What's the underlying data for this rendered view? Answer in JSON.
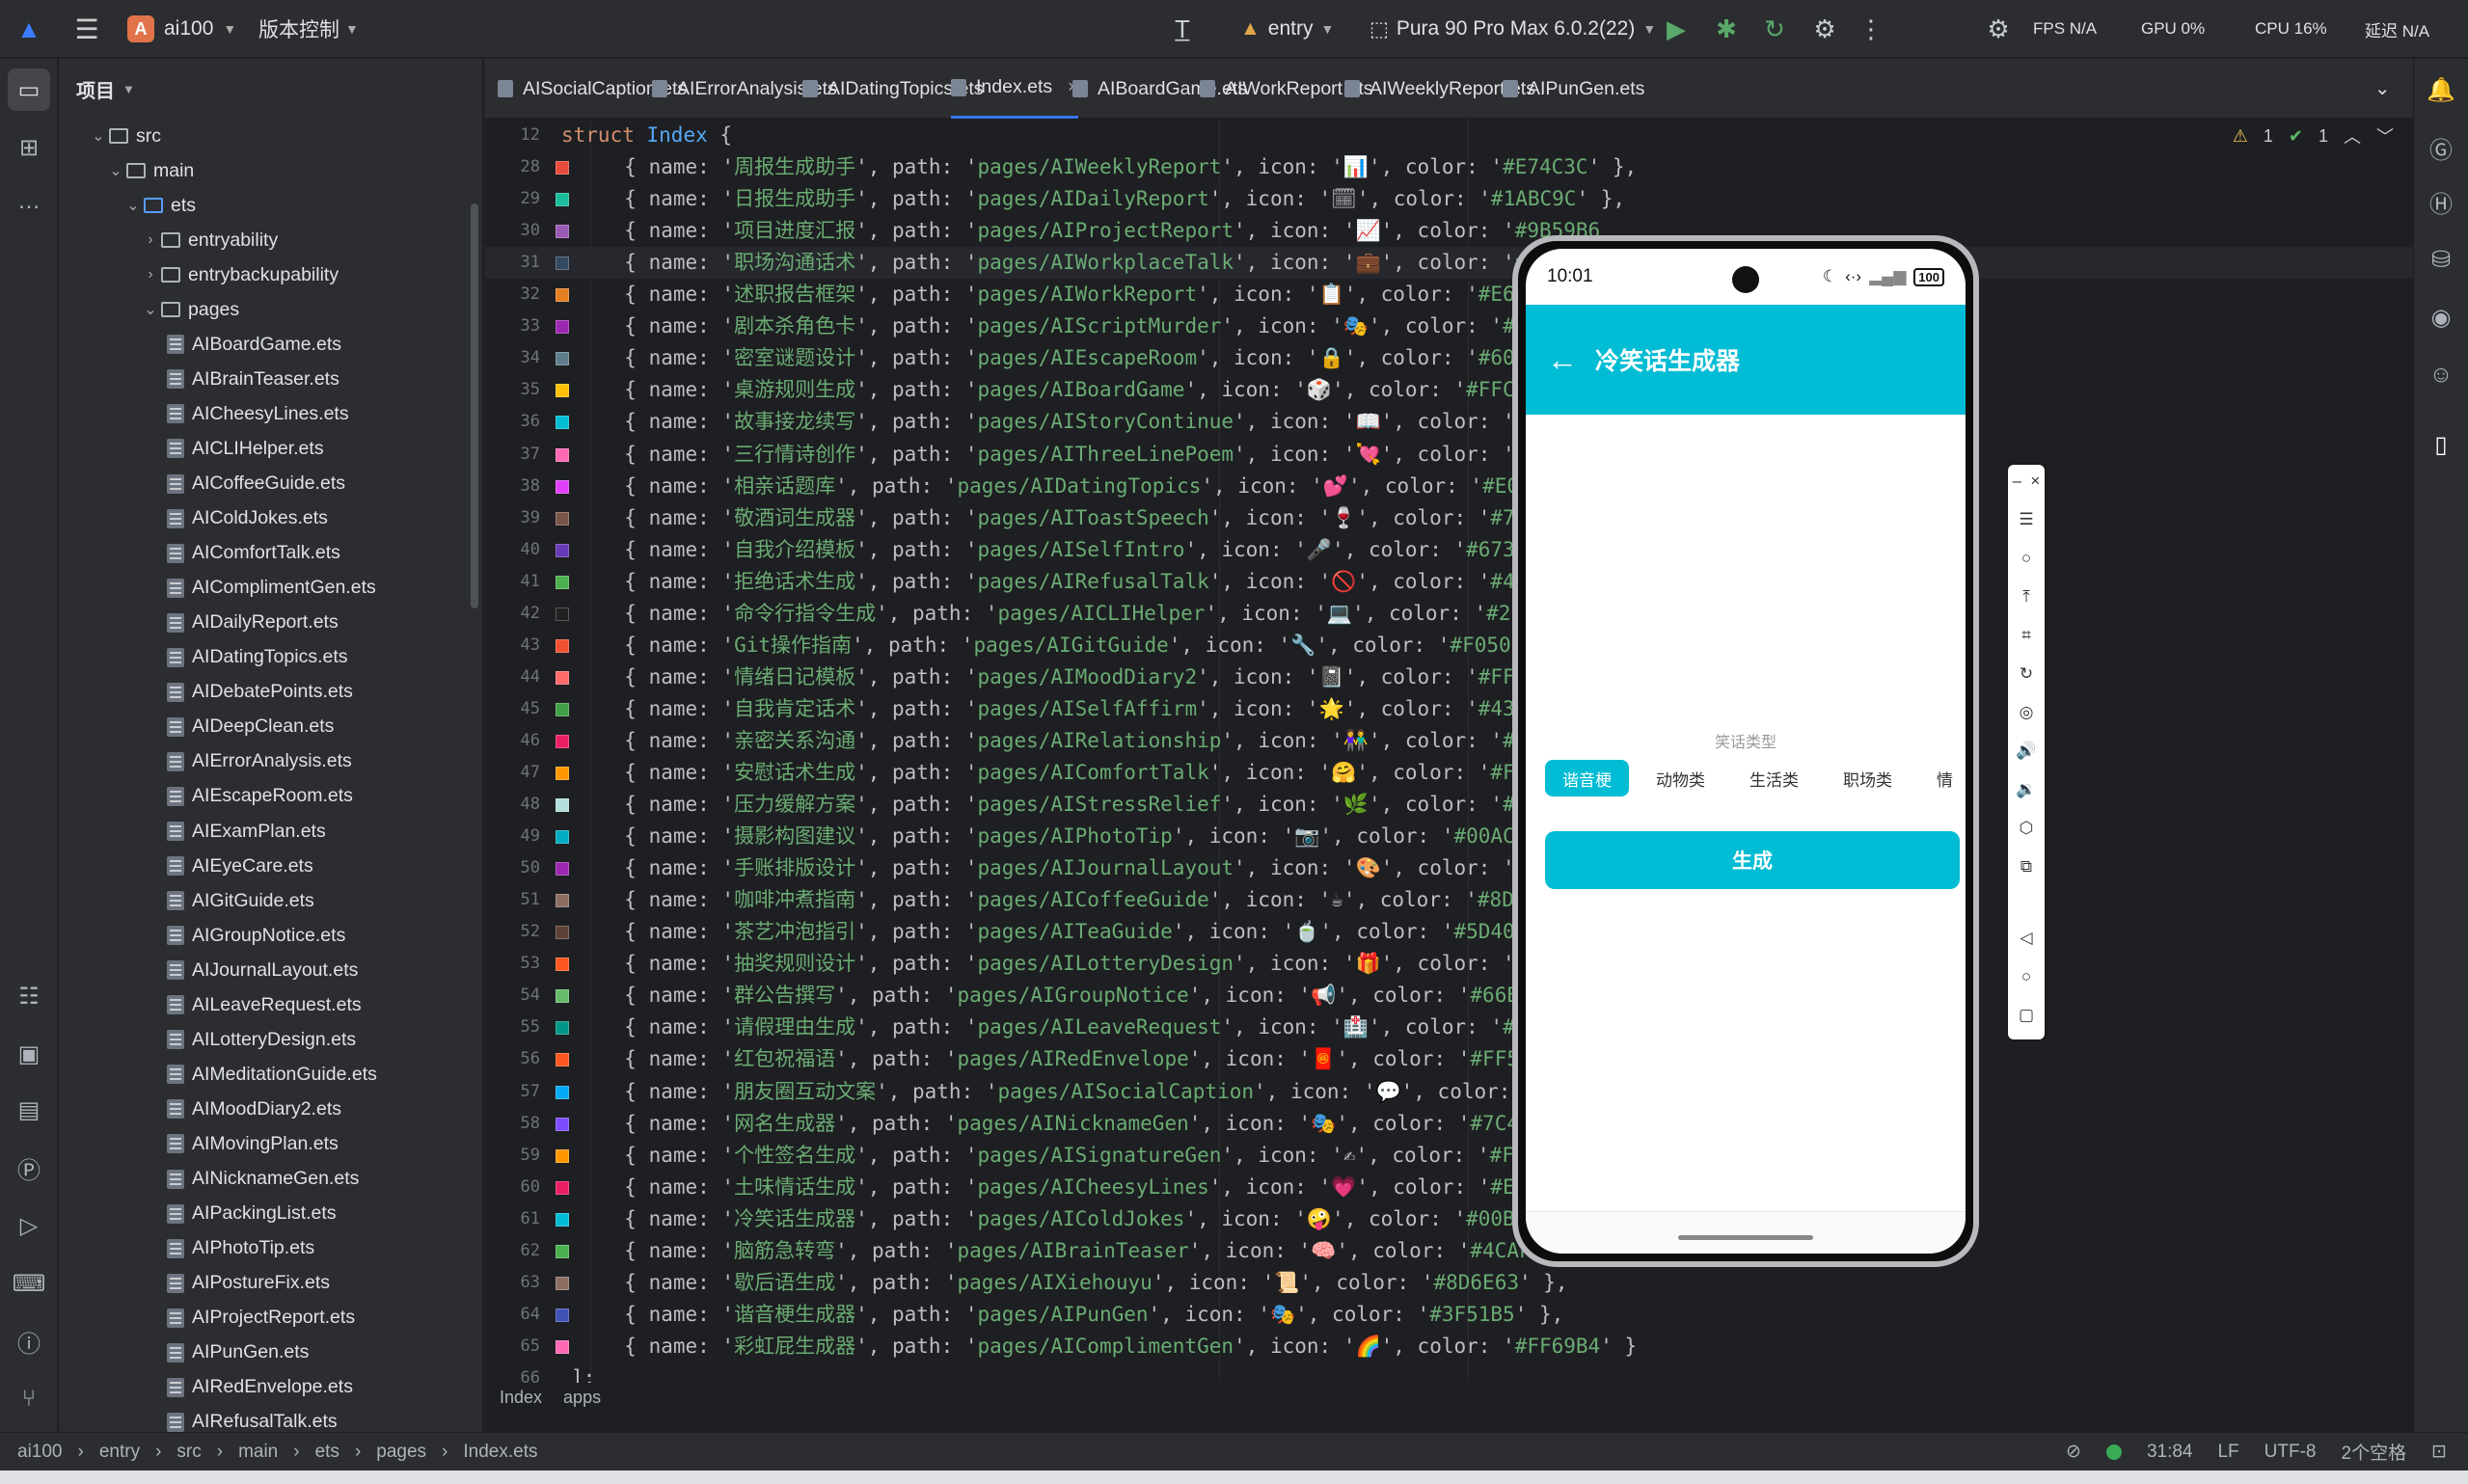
{
  "topbar": {
    "project_letter": "A",
    "project_name": "ai100",
    "vcs": "版本控制",
    "module": "entry",
    "device": "Pura 90 Pro Max 6.0.2(22)",
    "fps": "FPS N/A",
    "gpu": "GPU 0%",
    "cpu": "CPU 16%",
    "latency": "延迟 N/A"
  },
  "project_panel": {
    "title": "项目",
    "folders": [
      "src",
      "main",
      "ets",
      "entryability",
      "entrybackupability",
      "pages"
    ],
    "files": [
      "AIBoardGame.ets",
      "AIBrainTeaser.ets",
      "AICheesyLines.ets",
      "AICLIHelper.ets",
      "AICoffeeGuide.ets",
      "AIColdJokes.ets",
      "AIComfortTalk.ets",
      "AIComplimentGen.ets",
      "AIDailyReport.ets",
      "AIDatingTopics.ets",
      "AIDebatePoints.ets",
      "AIDeepClean.ets",
      "AIErrorAnalysis.ets",
      "AIEscapeRoom.ets",
      "AIExamPlan.ets",
      "AIEyeCare.ets",
      "AIGitGuide.ets",
      "AIGroupNotice.ets",
      "AIJournalLayout.ets",
      "AILeaveRequest.ets",
      "AILotteryDesign.ets",
      "AIMeditationGuide.ets",
      "AIMoodDiary2.ets",
      "AIMovingPlan.ets",
      "AINicknameGen.ets",
      "AIPackingList.ets",
      "AIPhotoTip.ets",
      "AIPostureFix.ets",
      "AIProjectReport.ets",
      "AIPunGen.ets",
      "AIRedEnvelope.ets",
      "AIRefusalTalk.ets"
    ]
  },
  "tabs": [
    "AISocialCaption.ets",
    "AIErrorAnalysis.ets",
    "AIDatingTopics.ets",
    "Index.ets",
    "AIBoardGame.ets",
    "AIWorkReport.ets",
    "AIWeeklyReport.ets",
    "AIPunGen.ets"
  ],
  "editor": {
    "header_kw": "struct",
    "header_cls": "Index",
    "header_tail": " {",
    "warnings": "1",
    "checks": "1",
    "lines": [
      {
        "n": "28",
        "name": "周报生成助手",
        "path": "pages/AIWeeklyReport",
        "icon": "📊",
        "color": "#E74C3C",
        "tail": "' },"
      },
      {
        "n": "29",
        "name": "日报生成助手",
        "path": "pages/AIDailyReport",
        "icon": "🗓",
        "color": "#1ABC9C",
        "tail": "' },"
      },
      {
        "n": "30",
        "name": "项目进度汇报",
        "path": "pages/AIProjectReport",
        "icon": "📈",
        "color": "#9B59B6",
        "tail": ""
      },
      {
        "n": "31",
        "name": "职场沟通话术",
        "path": "pages/AIWorkplaceTalk",
        "icon": "💼",
        "color": "#34495E",
        "tail": ""
      },
      {
        "n": "32",
        "name": "述职报告框架",
        "path": "pages/AIWorkReport",
        "icon": "📋",
        "color": "#E67E22",
        "tail": ""
      },
      {
        "n": "33",
        "name": "剧本杀角色卡",
        "path": "pages/AIScriptMurder",
        "icon": "🎭",
        "color": "#9C27B0",
        "tail": ""
      },
      {
        "n": "34",
        "name": "密室谜题设计",
        "path": "pages/AIEscapeRoom",
        "icon": "🔒",
        "color": "#607D8B",
        "tail": ""
      },
      {
        "n": "35",
        "name": "桌游规则生成",
        "path": "pages/AIBoardGame",
        "icon": "🎲",
        "color": "#FFC107",
        "tail": ""
      },
      {
        "n": "36",
        "name": "故事接龙续写",
        "path": "pages/AIStoryContinue",
        "icon": "📖",
        "color": "#00BCD4",
        "tail": ""
      },
      {
        "n": "37",
        "name": "三行情诗创作",
        "path": "pages/AIThreeLinePoem",
        "icon": "💘",
        "color": "#FF69B4",
        "tail": ""
      },
      {
        "n": "38",
        "name": "相亲话题库",
        "path": "pages/AIDatingTopics",
        "icon": "💕",
        "color": "#E040FB",
        "tail": ""
      },
      {
        "n": "39",
        "name": "敬酒词生成器",
        "path": "pages/AIToastSpeech",
        "icon": "🍷",
        "color": "#795548",
        "tail": ""
      },
      {
        "n": "40",
        "name": "自我介绍模板",
        "path": "pages/AISelfIntro",
        "icon": "🎤",
        "color": "#673AB7",
        "tail": ""
      },
      {
        "n": "41",
        "name": "拒绝话术生成",
        "path": "pages/AIRefusalTalk",
        "icon": "🚫",
        "color": "#4CAF50",
        "tail": ""
      },
      {
        "n": "42",
        "name": "命令行指令生成",
        "path": "pages/AICLIHelper",
        "icon": "💻",
        "color": "#212121",
        "tail": ""
      },
      {
        "n": "43",
        "name": "Git操作指南",
        "path": "pages/AIGitGuide",
        "icon": "🔧",
        "color": "#F05032",
        "tail": ""
      },
      {
        "n": "44",
        "name": "情绪日记模板",
        "path": "pages/AIMoodDiary2",
        "icon": "📓",
        "color": "#FF6B6B",
        "tail": ""
      },
      {
        "n": "45",
        "name": "自我肯定话术",
        "path": "pages/AISelfAffirm",
        "icon": "🌟",
        "color": "#43A047",
        "tail": ""
      },
      {
        "n": "46",
        "name": "亲密关系沟通",
        "path": "pages/AIRelationship",
        "icon": "👫",
        "color": "#E91E63",
        "tail": ""
      },
      {
        "n": "47",
        "name": "安慰话术生成",
        "path": "pages/AIComfortTalk",
        "icon": "🤗",
        "color": "#FF9800",
        "tail": ""
      },
      {
        "n": "48",
        "name": "压力缓解方案",
        "path": "pages/AIStressRelief",
        "icon": "🌿",
        "color": "#B2DFDB",
        "tail": ""
      },
      {
        "n": "49",
        "name": "摄影构图建议",
        "path": "pages/AIPhotoTip",
        "icon": "📷",
        "color": "#00ACC1",
        "tail": ""
      },
      {
        "n": "50",
        "name": "手账排版设计",
        "path": "pages/AIJournalLayout",
        "icon": "🎨",
        "color": "#9C27B0",
        "tail": ""
      },
      {
        "n": "51",
        "name": "咖啡冲煮指南",
        "path": "pages/AICoffeeGuide",
        "icon": "☕",
        "color": "#8D6E63",
        "tail": ""
      },
      {
        "n": "52",
        "name": "茶艺冲泡指引",
        "path": "pages/AITeaGuide",
        "icon": "🍵",
        "color": "#5D4037",
        "tail": ""
      },
      {
        "n": "53",
        "name": "抽奖规则设计",
        "path": "pages/AILotteryDesign",
        "icon": "🎁",
        "color": "#FF5722",
        "tail": ""
      },
      {
        "n": "54",
        "name": "群公告撰写",
        "path": "pages/AIGroupNotice",
        "icon": "📢",
        "color": "#66BB6A",
        "tail": ""
      },
      {
        "n": "55",
        "name": "请假理由生成",
        "path": "pages/AILeaveRequest",
        "icon": "🏥",
        "color": "#009688",
        "tail": ""
      },
      {
        "n": "56",
        "name": "红包祝福语",
        "path": "pages/AIRedEnvelope",
        "icon": "🧧",
        "color": "#FF5722",
        "tail": ""
      },
      {
        "n": "57",
        "name": "朋友圈互动文案",
        "path": "pages/AISocialCaption",
        "icon": "💬",
        "color": "#03A9F4",
        "tail": ""
      },
      {
        "n": "58",
        "name": "网名生成器",
        "path": "pages/AINicknameGen",
        "icon": "🎭",
        "color": "#7C4DFF",
        "tail": ""
      },
      {
        "n": "59",
        "name": "个性签名生成",
        "path": "pages/AISignatureGen",
        "icon": "✍",
        "color": "#FF9800",
        "tail": ""
      },
      {
        "n": "60",
        "name": "土味情话生成",
        "path": "pages/AICheesyLines",
        "icon": "💗",
        "color": "#E91E63",
        "tail": ""
      },
      {
        "n": "61",
        "name": "冷笑话生成器",
        "path": "pages/AIColdJokes",
        "icon": "🤪",
        "color": "#00BCD4",
        "tail": ""
      },
      {
        "n": "62",
        "name": "脑筋急转弯",
        "path": "pages/AIBrainTeaser",
        "icon": "🧠",
        "color": "#4CAF50",
        "tail": ""
      },
      {
        "n": "63",
        "name": "歇后语生成",
        "path": "pages/AIXiehouyu",
        "icon": "📜",
        "color": "#8D6E63",
        "tail": "' },"
      },
      {
        "n": "64",
        "name": "谐音梗生成器",
        "path": "pages/AIPunGen",
        "icon": "🎭",
        "color": "#3F51B5",
        "tail": "' },"
      },
      {
        "n": "65",
        "name": "彩虹屁生成器",
        "path": "pages/AIComplimentGen",
        "icon": "🌈",
        "color": "#FF69B4",
        "tail": "' }"
      }
    ],
    "close_line": "];",
    "close_num": "66",
    "header_num": "12",
    "breadcrumb": [
      "Index",
      "apps"
    ]
  },
  "phone": {
    "time": "10:01",
    "battery": "100",
    "title": "冷笑话生成器",
    "type_label": "笑话类型",
    "chips": [
      "谐音梗",
      "动物类",
      "生活类",
      "职场类",
      "情"
    ],
    "generate": "生成"
  },
  "status": {
    "path": [
      "ai100",
      "entry",
      "src",
      "main",
      "ets",
      "pages",
      "Index.ets"
    ],
    "position": "31:84",
    "line_sep": "LF",
    "encoding": "UTF-8",
    "indent": "2个空格"
  }
}
